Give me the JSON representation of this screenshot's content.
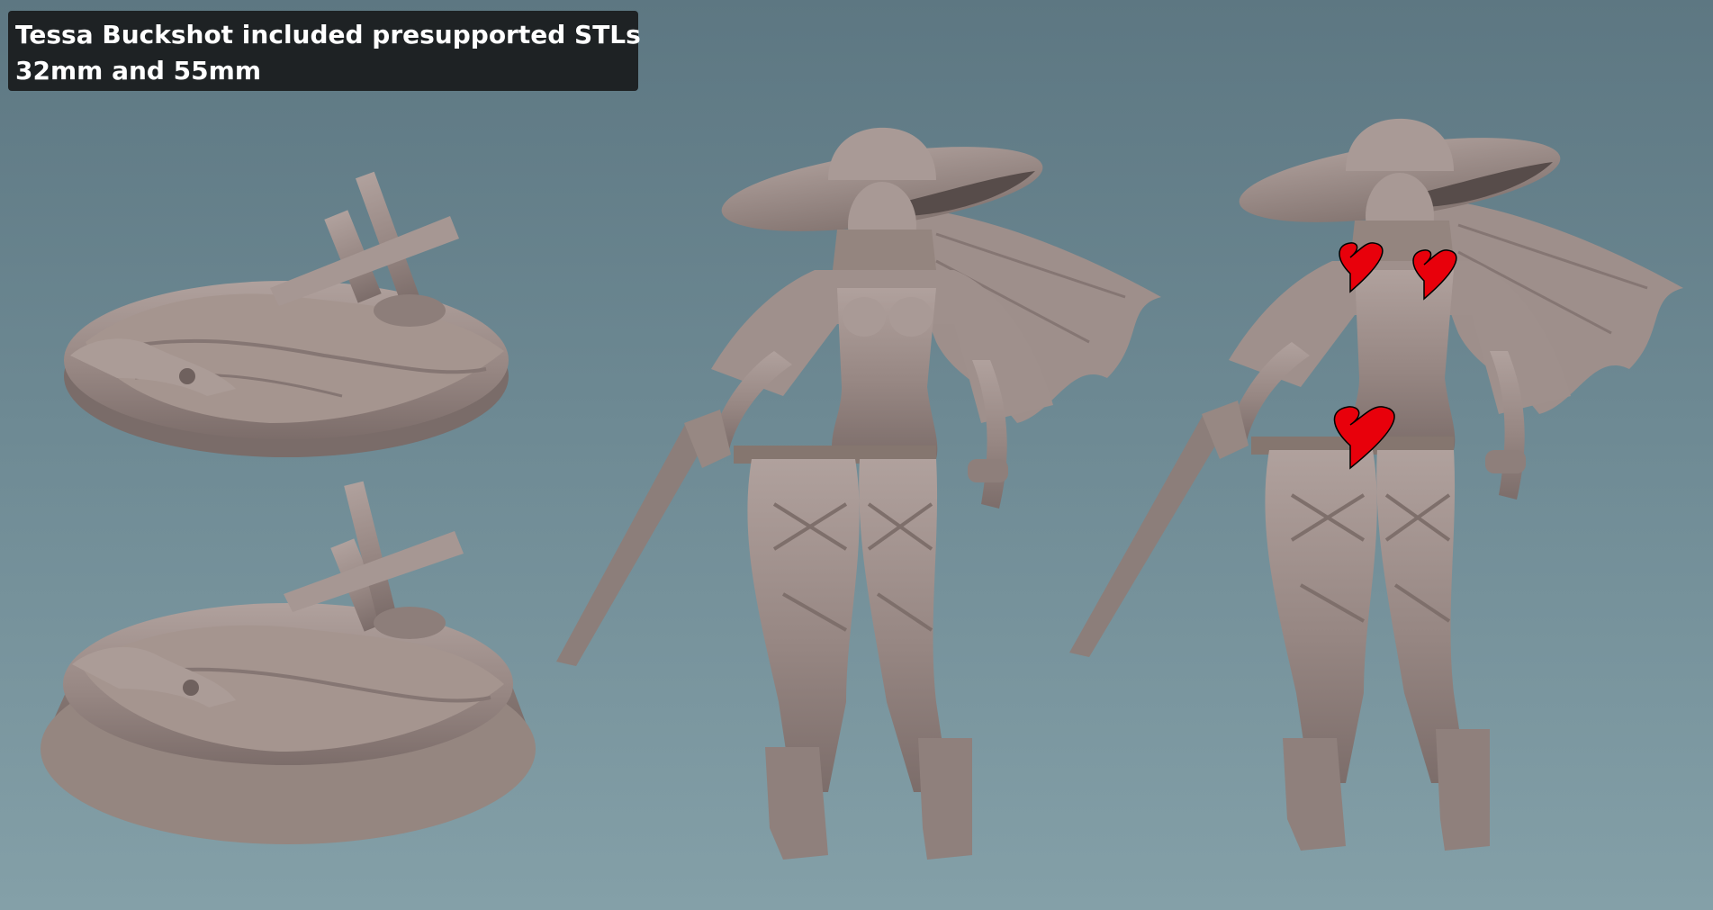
{
  "caption": {
    "line1": "Tessa Buckshot included presupported STLs",
    "line2": "32mm and 55mm"
  },
  "scene": {
    "background_color": "#6d8993",
    "model_color": "#978783",
    "censor_color": "#e8000b",
    "objects": [
      "base-32mm-render",
      "base-55mm-render",
      "figure-clothed-render",
      "figure-censored-render"
    ]
  }
}
